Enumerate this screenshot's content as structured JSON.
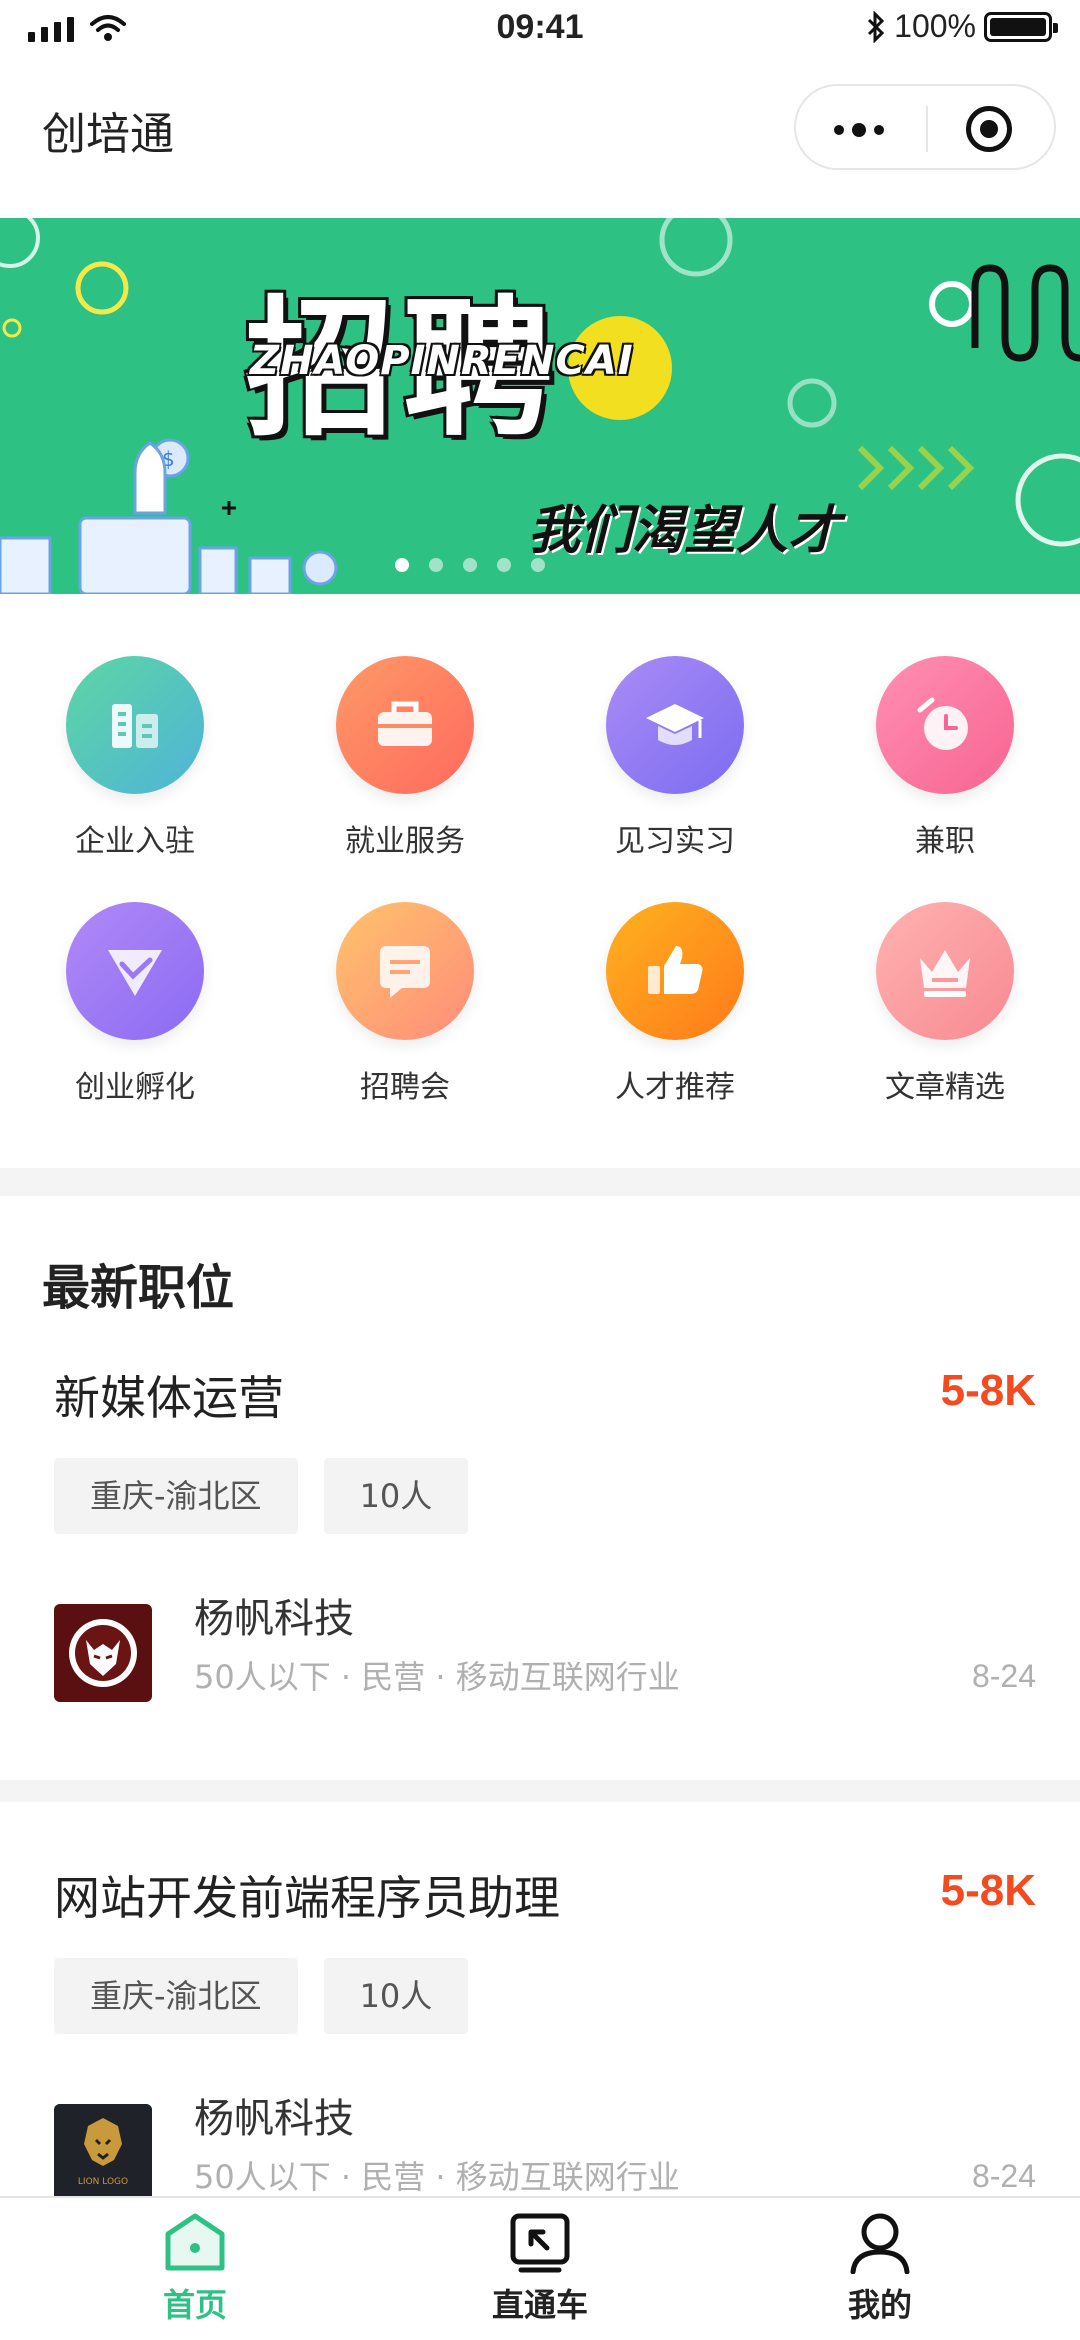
{
  "status_bar": {
    "time": "09:41",
    "battery": "100%"
  },
  "nav": {
    "title": "创培通"
  },
  "banner": {
    "title": "招聘",
    "pinyin": "ZHAOPINRENCAI",
    "slogan": "我们渴望人才",
    "slide_count": 5,
    "active_slide": 1
  },
  "grid": [
    {
      "label": "企业入驻",
      "icon": "building-icon",
      "color_from": "#5dd6a3",
      "color_to": "#4fb4d8"
    },
    {
      "label": "就业服务",
      "icon": "briefcase-icon",
      "color_from": "#ff9966",
      "color_to": "#ff6a5e"
    },
    {
      "label": "见习实习",
      "icon": "graduation-cap-icon",
      "color_from": "#a98cf6",
      "color_to": "#7c6cf0"
    },
    {
      "label": "兼职",
      "icon": "clock-icon",
      "color_from": "#ff8fb3",
      "color_to": "#f76592"
    },
    {
      "label": "创业孵化",
      "icon": "check-triangle-icon",
      "color_from": "#b189f7",
      "color_to": "#8a6bf2"
    },
    {
      "label": "招聘会",
      "icon": "message-icon",
      "color_from": "#ffc36b",
      "color_to": "#ff8c7a"
    },
    {
      "label": "人才推荐",
      "icon": "thumbs-up-icon",
      "color_from": "#ffb21f",
      "color_to": "#ff7a1a"
    },
    {
      "label": "文章精选",
      "icon": "crown-icon",
      "color_from": "#ffb3b0",
      "color_to": "#f78a92"
    }
  ],
  "section": {
    "title": "最新职位"
  },
  "jobs": [
    {
      "title": "新媒体运营",
      "salary": "5-8K",
      "location": "重庆-渝北区",
      "headcount": "10人",
      "company": "杨帆科技",
      "meta": "50人以下 · 民营 · 移动互联网行业",
      "date": "8-24"
    },
    {
      "title": "网站开发前端程序员助理",
      "salary": "5-8K",
      "location": "重庆-渝北区",
      "headcount": "10人",
      "company": "杨帆科技",
      "meta": "50人以下 · 民营 · 移动互联网行业",
      "date": "8-24",
      "logo_text": "LION LOGO"
    }
  ],
  "tabs": [
    {
      "label": "首页",
      "icon": "home-icon",
      "active": true
    },
    {
      "label": "直通车",
      "icon": "express-icon",
      "active": false
    },
    {
      "label": "我的",
      "icon": "user-icon",
      "active": false
    }
  ],
  "colors": {
    "accent": "#2ec184",
    "salary": "#f34a20"
  }
}
